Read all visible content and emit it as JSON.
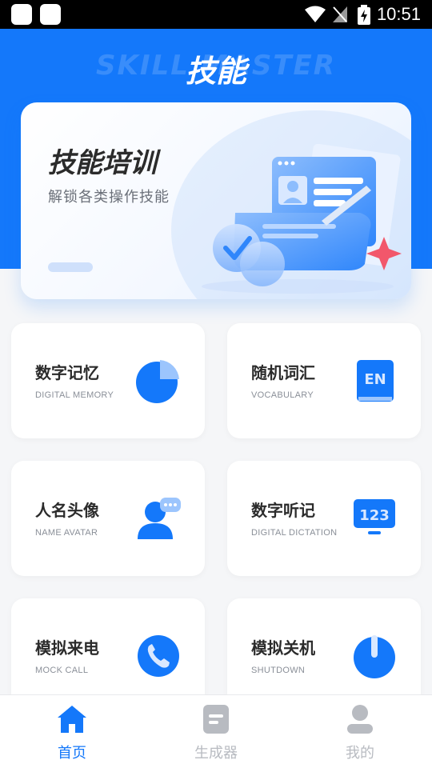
{
  "status_bar": {
    "time": "10:51"
  },
  "header": {
    "watermark": "SKILL MASTER",
    "title": "技能"
  },
  "banner": {
    "title": "技能培训",
    "subtitle": "解锁各类操作技能"
  },
  "cards": [
    {
      "title": "数字记忆",
      "subtitle": "DIGITAL MEMORY",
      "icon": "pie-chart-icon"
    },
    {
      "title": "随机词汇",
      "subtitle": "VOCABULARY",
      "icon": "en-book-icon"
    },
    {
      "title": "人名头像",
      "subtitle": "NAME AVATAR",
      "icon": "person-chat-icon"
    },
    {
      "title": "数字听记",
      "subtitle": "DIGITAL DICTATION",
      "icon": "monitor-123-icon"
    },
    {
      "title": "模拟来电",
      "subtitle": "MOCK CALL",
      "icon": "phone-icon"
    },
    {
      "title": "模拟关机",
      "subtitle": "SHUTDOWN",
      "icon": "power-icon"
    }
  ],
  "nav": [
    {
      "label": "首页",
      "icon": "home-icon",
      "active": true
    },
    {
      "label": "生成器",
      "icon": "document-icon",
      "active": false
    },
    {
      "label": "我的",
      "icon": "profile-icon",
      "active": false
    }
  ],
  "colors": {
    "primary": "#1478fa",
    "inactive": "#b8bbc1",
    "card_bg": "#ffffff",
    "page_bg": "#f5f6f8"
  }
}
